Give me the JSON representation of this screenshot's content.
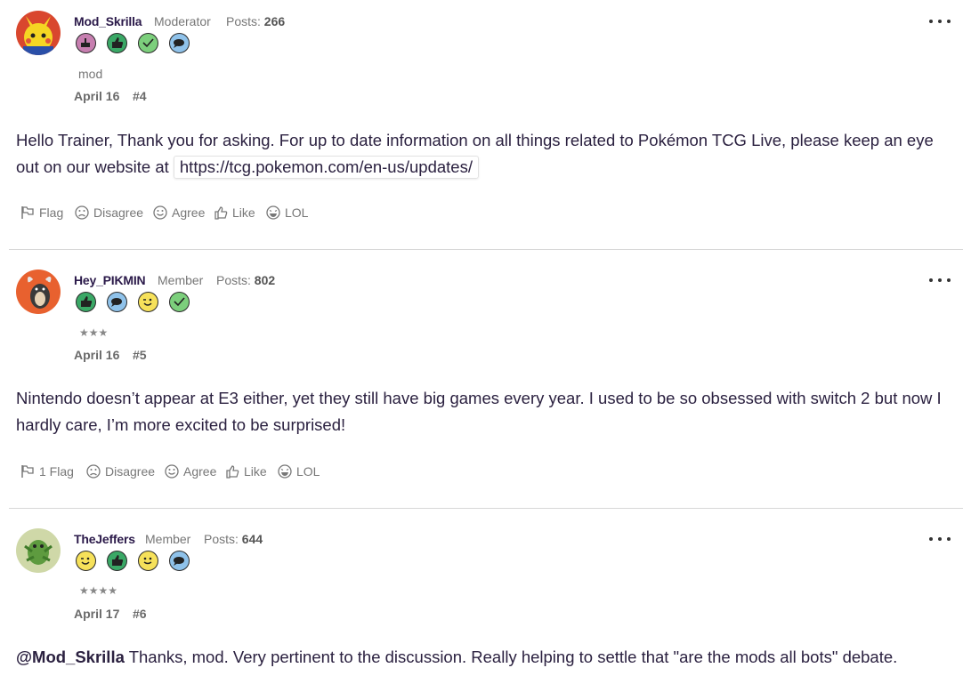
{
  "posts": [
    {
      "username": "Mod_Skrilla",
      "role": "Moderator",
      "posts_label": "Posts:",
      "posts_count": "266",
      "rank": "mod",
      "date": "April 16",
      "number": "#4",
      "body_text": "Hello Trainer, Thank you for asking. For up to date information on all things related to Pokémon TCG Live, please keep an eye out on our website at",
      "link": "https://tcg.pokemon.com/en-us/updates/",
      "reactions": {
        "flag": "Flag",
        "disagree": "Disagree",
        "agree": "Agree",
        "like": "Like",
        "lol": "LOL"
      }
    },
    {
      "username": "Hey_PIKMIN",
      "role": "Member",
      "posts_label": "Posts:",
      "posts_count": "802",
      "stars": "★★★",
      "date": "April 16",
      "number": "#5",
      "body_text": "Nintendo doesn’t appear at E3 either, yet they still have big games every year. I used to be so obsessed with switch 2 but now I hardly care, I’m more excited to be surprised!",
      "reactions": {
        "flag": "1 Flag",
        "disagree": "Disagree",
        "agree": "Agree",
        "like": "Like",
        "lol": "LOL"
      }
    },
    {
      "username": "TheJeffers",
      "role": "Member",
      "posts_label": "Posts:",
      "posts_count": "644",
      "stars": "★★★★",
      "date": "April 17",
      "number": "#6",
      "mention": "@Mod_Skrilla",
      "body_text": " Thanks, mod. Very pertinent to the discussion. Really helping to settle that \"are the mods all bots\" debate."
    }
  ],
  "badge_colors": {
    "cake": "#c77fb0",
    "like": "#3aa866",
    "check": "#7ccf7c",
    "comment": "#8fc2ea",
    "wink": "#f6e15a",
    "smile": "#f6e15a"
  }
}
